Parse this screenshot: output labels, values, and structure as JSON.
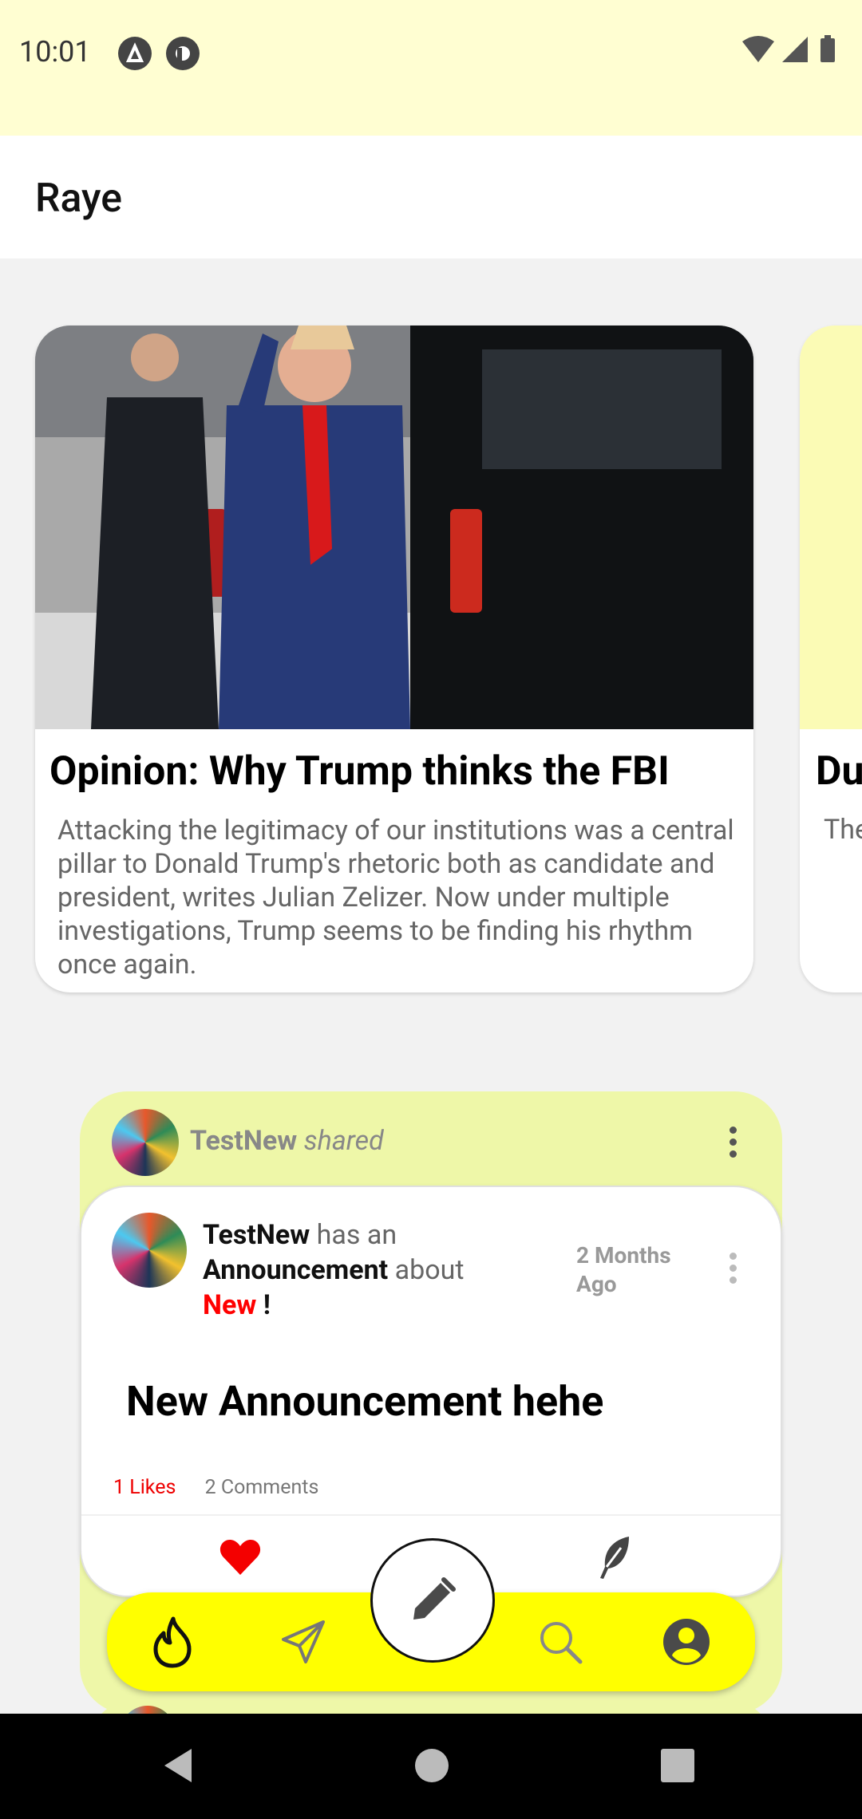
{
  "status_bar": {
    "time": "10:01"
  },
  "app_bar": {
    "title": "Raye"
  },
  "news": [
    {
      "title": "Opinion: Why Trump thinks the FBI",
      "description": "Attacking the legitimacy of our institutions was a central pillar to Donald Trump's rhetoric both as candidate and president, writes Julian Zelizer. Now under multiple investigations, Trump seems to be finding his rhythm once again."
    },
    {
      "title": "Du",
      "description": "The"
    }
  ],
  "share_post": {
    "sharer": "TestNew",
    "shared_label": "shared",
    "author": "TestNew",
    "has_an": "has an",
    "type": "Announcement",
    "about": "about",
    "topic": "New",
    "exclamation": "!",
    "time_ago": "2 Months Ago",
    "title": "New Announcement hehe",
    "likes": "1 Likes",
    "comments": "2 Comments"
  },
  "bottom_nav": {
    "items": [
      "fire-icon",
      "send-icon",
      "edit-icon",
      "search-icon",
      "account-icon"
    ]
  },
  "colors": {
    "status_bg": "#fffed2",
    "nav_yellow": "#ffff00",
    "share_green": "#eef7a8",
    "like_red": "#ff0000"
  }
}
